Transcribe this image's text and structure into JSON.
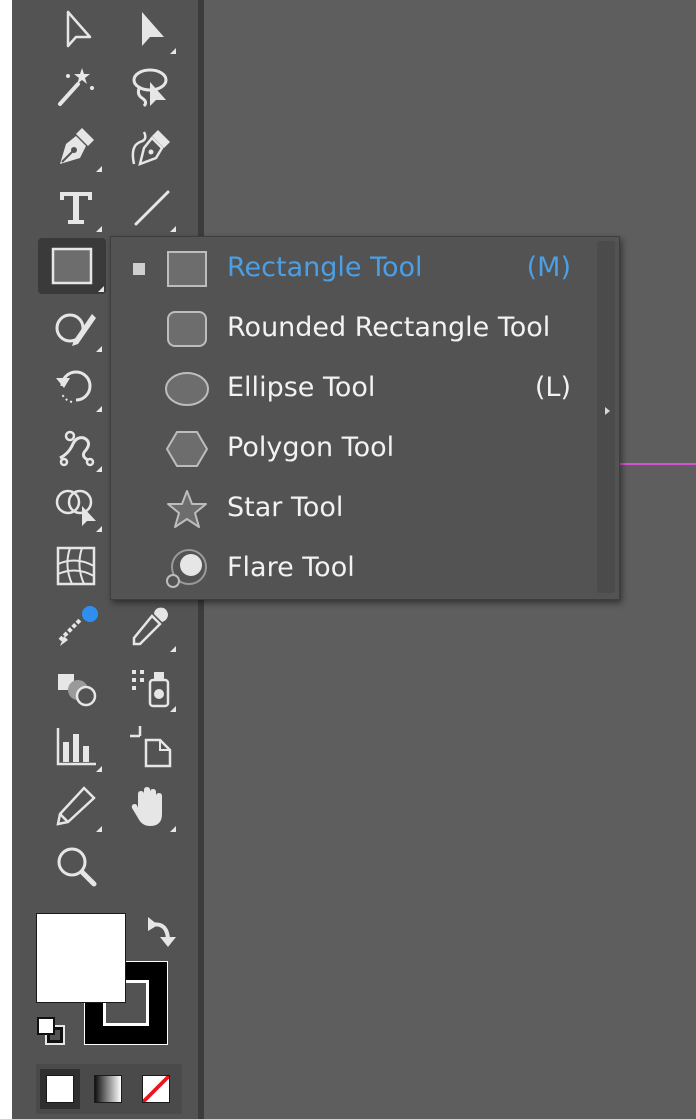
{
  "toolbar": {
    "tools": [
      {
        "name": "selection-tool",
        "icon": "arrow-outline-icon"
      },
      {
        "name": "direct-selection-tool",
        "icon": "arrow-solid-icon"
      },
      {
        "name": "magic-wand-tool",
        "icon": "magic-wand-icon"
      },
      {
        "name": "lasso-tool",
        "icon": "lasso-icon"
      },
      {
        "name": "pen-tool",
        "icon": "pen-icon"
      },
      {
        "name": "curvature-tool",
        "icon": "curvature-pen-icon"
      },
      {
        "name": "type-tool",
        "icon": "type-icon"
      },
      {
        "name": "line-segment-tool",
        "icon": "line-icon"
      },
      {
        "name": "rectangle-tool",
        "icon": "rectangle-icon",
        "active": true
      },
      {
        "name": "shaper-tool",
        "icon": "shaper-pencil-icon"
      },
      {
        "name": "rotate-tool",
        "icon": "rotate-icon"
      },
      {
        "name": "puppet-warp-tool",
        "icon": "puppet-warp-icon"
      },
      {
        "name": "shape-builder-tool",
        "icon": "shape-builder-icon"
      },
      {
        "name": "mesh-tool",
        "icon": "mesh-icon"
      },
      {
        "name": "gradient-annotator-tool",
        "icon": "gradient-icon"
      },
      {
        "name": "eyedropper-tool",
        "icon": "eyedropper-icon"
      },
      {
        "name": "blend-tool",
        "icon": "blend-icon"
      },
      {
        "name": "symbol-sprayer-tool",
        "icon": "symbol-sprayer-icon"
      },
      {
        "name": "graph-tool",
        "icon": "column-graph-icon"
      },
      {
        "name": "artboard-tool",
        "icon": "artboard-icon"
      },
      {
        "name": "slice-tool",
        "icon": "slice-knife-icon"
      },
      {
        "name": "hand-tool",
        "icon": "hand-icon"
      },
      {
        "name": "zoom-tool",
        "icon": "magnifier-icon"
      }
    ]
  },
  "flyout": {
    "items": [
      {
        "label": "Rectangle Tool",
        "shortcut": "(M)",
        "selected": true,
        "icon": "rectangle-icon"
      },
      {
        "label": "Rounded Rectangle Tool",
        "shortcut": "",
        "icon": "rounded-rectangle-icon"
      },
      {
        "label": "Ellipse Tool",
        "shortcut": "(L)",
        "icon": "ellipse-icon"
      },
      {
        "label": "Polygon Tool",
        "shortcut": "",
        "icon": "polygon-icon"
      },
      {
        "label": "Star Tool",
        "shortcut": "",
        "icon": "star-icon"
      },
      {
        "label": "Flare Tool",
        "shortcut": "",
        "icon": "flare-icon"
      }
    ]
  },
  "colors": {
    "fill": "#ffffff",
    "stroke": "#000000",
    "selected_text": "#4b9fe6",
    "guide": "#d553d5"
  },
  "color_modes": [
    "color-mode-icon",
    "gradient-mode-icon",
    "none-mode-icon"
  ]
}
